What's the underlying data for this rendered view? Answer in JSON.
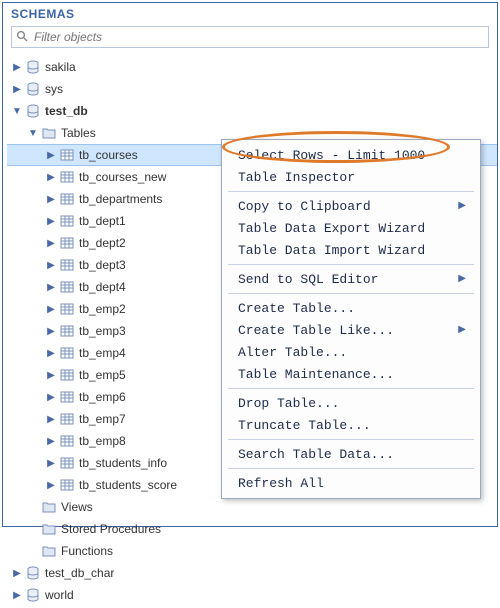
{
  "panel_title": "SCHEMAS",
  "filter": {
    "placeholder": "Filter objects"
  },
  "databases": {
    "sakila": "sakila",
    "sys": "sys",
    "test_db": "test_db",
    "test_db_char": "test_db_char",
    "world": "world"
  },
  "test_db_nodes": {
    "tables": "Tables",
    "views": "Views",
    "stored_procedures": "Stored Procedures",
    "functions": "Functions"
  },
  "tables": [
    "tb_courses",
    "tb_courses_new",
    "tb_departments",
    "tb_dept1",
    "tb_dept2",
    "tb_dept3",
    "tb_dept4",
    "tb_emp2",
    "tb_emp3",
    "tb_emp4",
    "tb_emp5",
    "tb_emp6",
    "tb_emp7",
    "tb_emp8",
    "tb_students_info",
    "tb_students_score"
  ],
  "context_menu": {
    "select_rows": "Select Rows - Limit 1000",
    "table_inspector": "Table Inspector",
    "copy_clipboard": "Copy to Clipboard",
    "export_wizard": "Table Data Export Wizard",
    "import_wizard": "Table Data Import Wizard",
    "send_sql": "Send to SQL Editor",
    "create_table": "Create Table...",
    "create_table_like": "Create Table Like...",
    "alter_table": "Alter Table...",
    "table_maintenance": "Table Maintenance...",
    "drop_table": "Drop Table...",
    "truncate_table": "Truncate Table...",
    "search_table_data": "Search Table Data...",
    "refresh_all": "Refresh All"
  }
}
